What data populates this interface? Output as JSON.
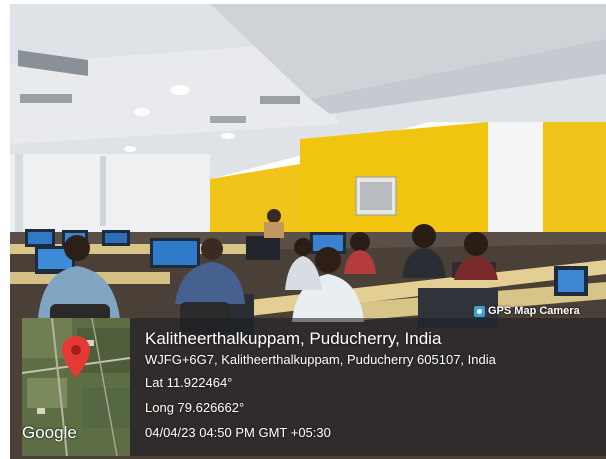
{
  "badge": {
    "label": "GPS Map Camera",
    "icon": "camera-icon"
  },
  "location": {
    "title": "Kalitheerthalkuppam, Puducherry, India",
    "address": "WJFG+6G7, Kalitheerthalkuppam, Puducherry 605107, India",
    "latitude": "Lat 11.922464°",
    "longitude": "Long 79.626662°",
    "datetime": "04/04/23 04:50 PM GMT +05:30"
  },
  "map": {
    "attribution": "Google",
    "pin_color": "#e53935"
  },
  "colors": {
    "wall_yellow": "#f1c40f",
    "ceiling": "#dcdfe3",
    "overlay": "#191c22"
  }
}
